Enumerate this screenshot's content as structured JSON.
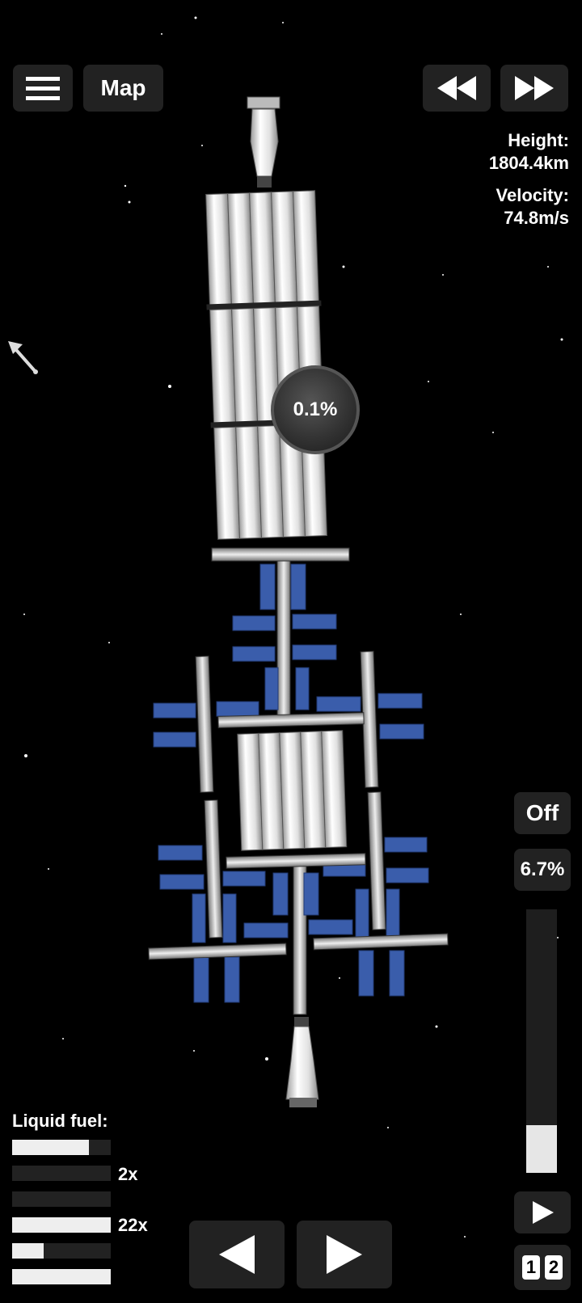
{
  "top_bar": {
    "map_label": "Map"
  },
  "info": {
    "height_label": "Height:",
    "height_value": "1804.4km",
    "velocity_label": "Velocity:",
    "velocity_value": "74.8m/s"
  },
  "progress_circle": {
    "text": "0.1%"
  },
  "throttle": {
    "toggle_label": "Off",
    "percent_label": "6.7%",
    "level": 0.067
  },
  "fuel": {
    "title": "Liquid fuel:",
    "bars": [
      {
        "fill": 0.78,
        "multiplier": ""
      },
      {
        "fill": 0.0,
        "multiplier": "2x"
      },
      {
        "fill": 0.0,
        "multiplier": ""
      },
      {
        "fill": 1.0,
        "multiplier": "22x"
      },
      {
        "fill": 0.32,
        "multiplier": ""
      },
      {
        "fill": 1.0,
        "multiplier": ""
      }
    ]
  },
  "bottom": {
    "time_digits": [
      "1",
      "2"
    ]
  },
  "colors": {
    "button_bg": "#222222",
    "panel_blue": "#3a5dab",
    "fuel_fill": "#eeeeee"
  },
  "icons": [
    "menu-icon",
    "rewind-icon",
    "fast-forward-icon",
    "cursor-arrow-icon",
    "play-icon",
    "arrow-left-icon",
    "arrow-right-icon"
  ]
}
